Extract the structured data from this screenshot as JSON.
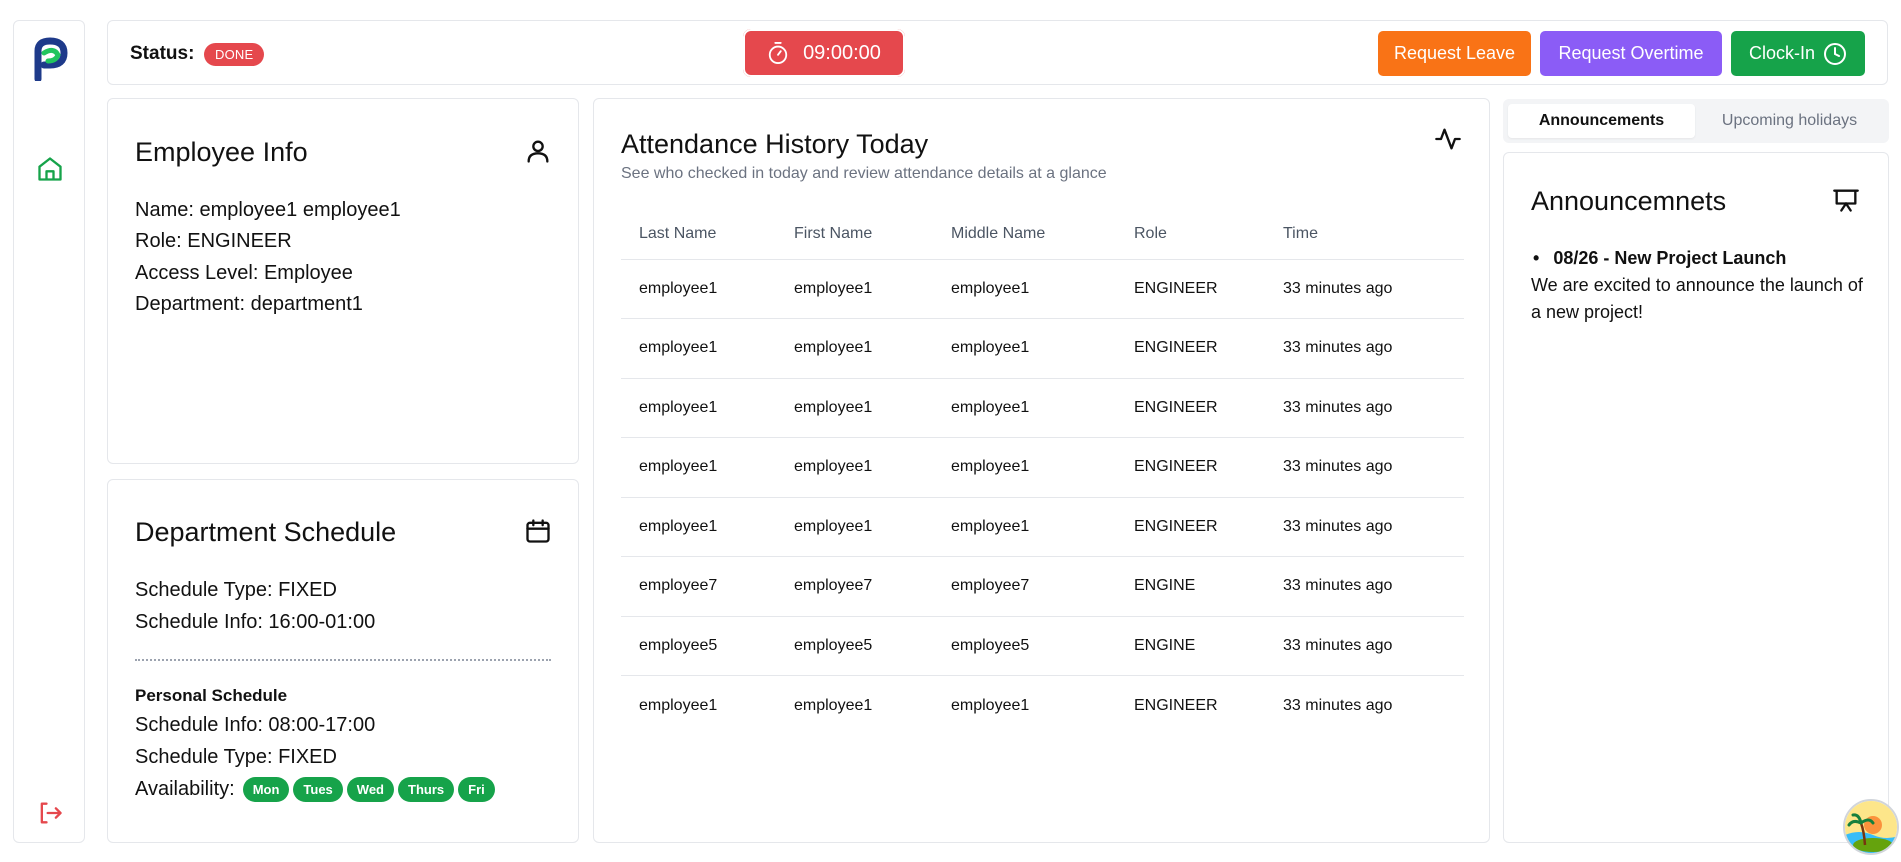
{
  "sidebar": {
    "logo_icon": "logo",
    "home_icon": "home-icon",
    "logout_icon": "logout-icon",
    "accent": "#16a34a",
    "logout_color": "#e5484d"
  },
  "topbar": {
    "status_label": "Status:",
    "status_badge": "DONE",
    "timer": "09:00:00",
    "request_leave": "Request Leave",
    "request_overtime": "Request Overtime",
    "clock_in": "Clock-In"
  },
  "employee_info": {
    "title": "Employee Info",
    "name": "Name: employee1 employee1",
    "role": "Role: ENGINEER",
    "access_level": "Access Level: Employee",
    "department": "Department: department1"
  },
  "department_schedule": {
    "title": "Department Schedule",
    "schedule_type": "Schedule Type: FIXED",
    "schedule_info": "Schedule Info: 16:00-01:00",
    "personal_heading": "Personal Schedule",
    "personal_info": "Schedule Info: 08:00-17:00",
    "personal_type": "Schedule Type: FIXED",
    "availability_label": "Availability:",
    "days": [
      "Mon",
      "Tues",
      "Wed",
      "Thurs",
      "Fri"
    ]
  },
  "attendance": {
    "title": "Attendance History Today",
    "subtitle": "See who checked in today and review attendance details at a glance",
    "columns": [
      "Last Name",
      "First Name",
      "Middle Name",
      "Role",
      "Time"
    ],
    "rows": [
      [
        "employee1",
        "employee1",
        "employee1",
        "ENGINEER",
        "33 minutes ago"
      ],
      [
        "employee1",
        "employee1",
        "employee1",
        "ENGINEER",
        "33 minutes ago"
      ],
      [
        "employee1",
        "employee1",
        "employee1",
        "ENGINEER",
        "33 minutes ago"
      ],
      [
        "employee1",
        "employee1",
        "employee1",
        "ENGINEER",
        "33 minutes ago"
      ],
      [
        "employee1",
        "employee1",
        "employee1",
        "ENGINEER",
        "33 minutes ago"
      ],
      [
        "employee7",
        "employee7",
        "employee7",
        "ENGINE",
        "33 minutes ago"
      ],
      [
        "employee5",
        "employee5",
        "employee5",
        "ENGINE",
        "33 minutes ago"
      ],
      [
        "employee1",
        "employee1",
        "employee1",
        "ENGINEER",
        "33 minutes ago"
      ]
    ]
  },
  "tabs": {
    "announcements": "Announcements",
    "holidays": "Upcoming holidays"
  },
  "announcements": {
    "title": "Announcemnets",
    "item_heading": "08/26 - New Project Launch",
    "item_body": "We are excited to announce the launch of a new project!"
  },
  "colors": {
    "danger": "#e5484d",
    "orange": "#f97316",
    "purple": "#8b5cf6",
    "green": "#16a34a"
  }
}
